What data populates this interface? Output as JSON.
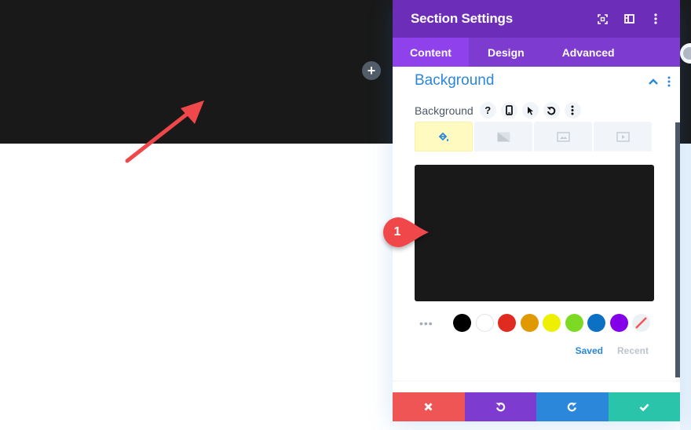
{
  "page": {
    "add_row_label": "+",
    "annotation_badge": "1"
  },
  "panel": {
    "title": "Section Settings",
    "header_icons": [
      "fullscreen-icon",
      "split-view-icon",
      "more-options-icon"
    ],
    "tabs": [
      {
        "label": "Content",
        "active": true
      },
      {
        "label": "Design",
        "active": false
      },
      {
        "label": "Advanced",
        "active": false
      }
    ],
    "section": {
      "title": "Background",
      "expanded": true
    },
    "field": {
      "label": "Background",
      "option_icons": [
        "help-icon",
        "responsive-phone-icon",
        "hover-cursor-icon",
        "reset-icon",
        "more-options-icon"
      ]
    },
    "background_tabs": [
      {
        "name": "color",
        "icon": "paint-bucket-icon",
        "active": true
      },
      {
        "name": "gradient",
        "icon": "gradient-icon",
        "active": false
      },
      {
        "name": "image",
        "icon": "image-icon",
        "active": false
      },
      {
        "name": "video",
        "icon": "video-icon",
        "active": false
      }
    ],
    "selected_color": "#191919",
    "swatches": [
      {
        "name": "black",
        "color": "#000000"
      },
      {
        "name": "white",
        "color": "#ffffff"
      },
      {
        "name": "red",
        "color": "#e02b20"
      },
      {
        "name": "orange",
        "color": "#e09900"
      },
      {
        "name": "yellow",
        "color": "#edf000"
      },
      {
        "name": "green",
        "color": "#7cda24"
      },
      {
        "name": "blue",
        "color": "#0c71c3"
      },
      {
        "name": "purple",
        "color": "#8300e9"
      },
      {
        "name": "none",
        "color": "transparent"
      }
    ],
    "palette_links": {
      "saved": "Saved",
      "recent": "Recent"
    },
    "footer_buttons": [
      {
        "name": "discard",
        "icon": "close-icon",
        "color": "#ef5555"
      },
      {
        "name": "undo",
        "icon": "undo-icon",
        "color": "#7e3bd0"
      },
      {
        "name": "redo",
        "icon": "redo-icon",
        "color": "#2b87da"
      },
      {
        "name": "save",
        "icon": "check-icon",
        "color": "#29c4a9"
      }
    ]
  }
}
